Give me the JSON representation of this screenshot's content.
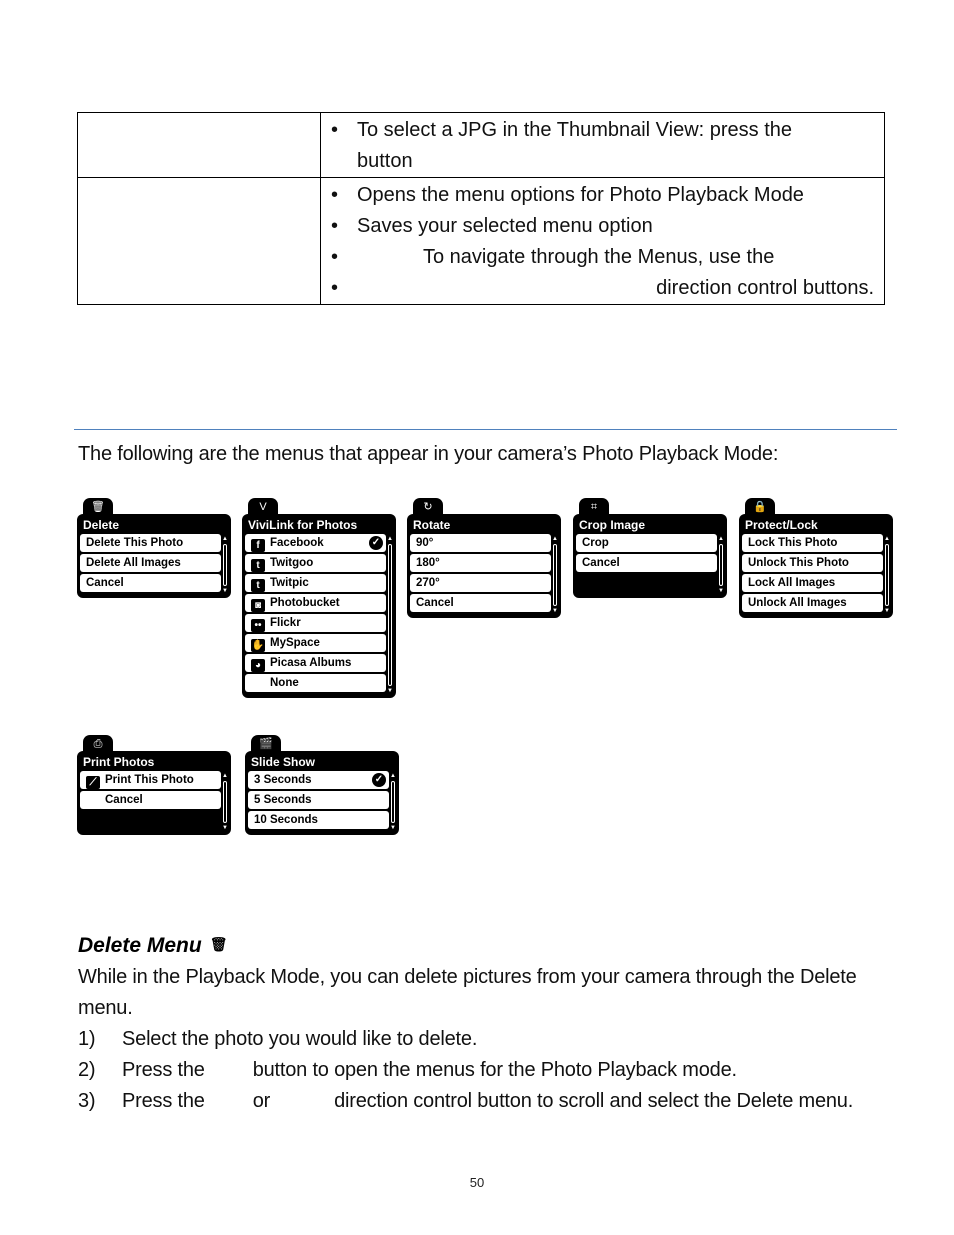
{
  "table": {
    "rows": [
      {
        "label": "",
        "bullets": [
          "To select a JPG in the Thumbnail View: press the button"
        ]
      },
      {
        "label": "",
        "bullets": [
          "Opens the menu options for Photo Playback Mode",
          "Saves your selected menu option",
          "To navigate through the Menus, use the",
          "direction control buttons."
        ]
      }
    ],
    "row1_line1": "To select a JPG in the Thumbnail View: press the",
    "row1_line2": "button",
    "bullet_char": "•"
  },
  "intro": "The following are the menus that appear in your camera’s Photo Playback Mode:",
  "menus": [
    {
      "icon": "trash-icon",
      "icon_glyph": "🗑",
      "title": "Delete",
      "items": [
        {
          "label": "Delete This Photo"
        },
        {
          "label": "Delete All Images"
        },
        {
          "label": "Cancel"
        }
      ]
    },
    {
      "icon": "vivilink-icon",
      "icon_glyph": "V",
      "title": "ViviLink for Photos",
      "items": [
        {
          "label": "Facebook",
          "icon": "f",
          "checked": true
        },
        {
          "label": "Twitgoo",
          "icon": "t"
        },
        {
          "label": "Twitpic",
          "icon": "t"
        },
        {
          "label": "Photobucket",
          "icon": "◙"
        },
        {
          "label": "Flickr",
          "icon": "••"
        },
        {
          "label": "MySpace",
          "icon": "✋"
        },
        {
          "label": "Picasa Albums",
          "icon": "◕"
        },
        {
          "label": "None"
        }
      ]
    },
    {
      "icon": "rotate-icon",
      "icon_glyph": "↻",
      "title": "Rotate",
      "items": [
        {
          "label": "90°"
        },
        {
          "label": "180°"
        },
        {
          "label": "270°"
        },
        {
          "label": "Cancel"
        }
      ]
    },
    {
      "icon": "crop-icon",
      "icon_glyph": "⌗",
      "title": "Crop Image",
      "items": [
        {
          "label": "Crop"
        },
        {
          "label": "Cancel"
        }
      ]
    },
    {
      "icon": "lock-icon",
      "icon_glyph": "🔒",
      "title": "Protect/Lock",
      "items": [
        {
          "label": "Lock This Photo"
        },
        {
          "label": "Unlock This Photo"
        },
        {
          "label": "Lock  All Images"
        },
        {
          "label": "Unlock All Images"
        }
      ]
    },
    {
      "icon": "print-icon",
      "icon_glyph": "⎙",
      "title": "Print Photos",
      "items": [
        {
          "label": "Print This Photo",
          "icon": "⟋"
        },
        {
          "label": "Cancel"
        }
      ]
    },
    {
      "icon": "slideshow-icon",
      "icon_glyph": "🎬",
      "title": "Slide Show",
      "items": [
        {
          "label": "3 Seconds",
          "checked": true
        },
        {
          "label": "5 Seconds"
        },
        {
          "label": "10 Seconds"
        }
      ]
    }
  ],
  "delete_section": {
    "heading": "Delete Menu",
    "heading_icon": "🗑",
    "paragraph": "While in the Playback Mode, you can delete pictures from your camera through the Delete menu.",
    "steps": [
      {
        "num": "1)",
        "parts": [
          "Select the photo you would like to delete."
        ]
      },
      {
        "num": "2)",
        "parts": [
          "Press the",
          "button to open the menus for the Photo Playback mode."
        ]
      },
      {
        "num": "3)",
        "parts": [
          "Press the",
          "or",
          "direction control button to scroll and select the Delete menu."
        ]
      }
    ]
  },
  "page_number": "50",
  "colors": {
    "rule": "#4f81bd",
    "menu_bg": "#000000",
    "menu_item_bg": "#ffffff"
  }
}
